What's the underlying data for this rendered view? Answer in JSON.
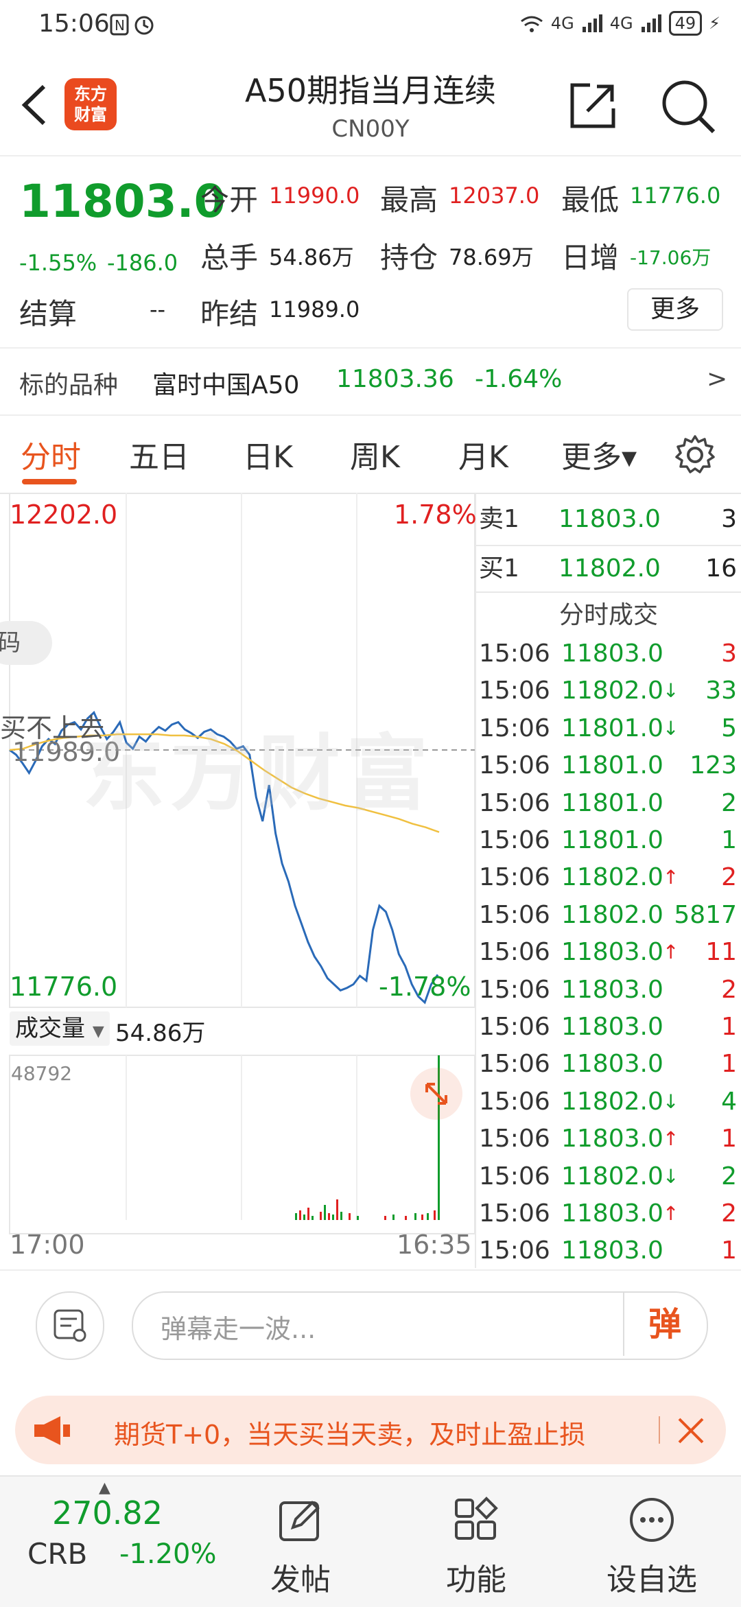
{
  "status_bar": {
    "time": "15:06",
    "battery": "49",
    "net1": "4G",
    "net2": "4G"
  },
  "header": {
    "logo_line1": "东方",
    "logo_line2": "财富",
    "title": "A50期指当月连续",
    "code": "CN00Y"
  },
  "quote": {
    "price": "11803.0",
    "change_pct": "-1.55%",
    "change": "-186.0",
    "open_label": "今开",
    "open": "11990.0",
    "high_label": "最高",
    "high": "12037.0",
    "low_label": "最低",
    "low": "11776.0",
    "volume_label": "总手",
    "volume": "54.86万",
    "oi_label": "持仓",
    "oi": "78.69万",
    "daily_inc_label": "日增",
    "daily_inc": "-17.06万",
    "settle_label": "结算",
    "settle": "--",
    "prev_settle_label": "昨结",
    "prev_settle": "11989.0",
    "more_label": "更多"
  },
  "underlying": {
    "label": "标的品种",
    "name": "富时中国A50",
    "price": "11803.36",
    "change_pct": "-1.64%",
    "arrow": ">"
  },
  "tabs": [
    "分时",
    "五日",
    "日K",
    "周K",
    "月K",
    "更多▾"
  ],
  "chart": {
    "high_price": "12202.0",
    "high_pct": "1.78%",
    "ref_price": "11989.0",
    "low_price": "11776.0",
    "low_pct": "-1.78%",
    "side_pill_text": "码",
    "side_overlay_text": "买不上去",
    "watermark": "东方财富",
    "volume_dropdown": "成交量",
    "volume_value": "54.86万",
    "volume_max": "48792",
    "time_start": "17:00",
    "time_end": "16:35"
  },
  "chart_data": {
    "type": "line",
    "ylim": [
      11776.0,
      12202.0
    ],
    "reference": 11989.0,
    "series": [
      {
        "values": [
          11989,
          11985,
          11978,
          11970,
          11980,
          11992,
          11998,
          11994,
          12005,
          12010,
          12012,
          12006,
          12015,
          12020,
          12008,
          11998,
          12004,
          12012,
          11995,
          11990,
          12000,
          11996,
          12003,
          12008,
          12005,
          12010,
          12012,
          12006,
          12003,
          11999,
          12004,
          12006,
          12002,
          12000,
          11996,
          11990,
          11992,
          11985,
          11950,
          11930,
          11960,
          11920,
          11895,
          11880,
          11860,
          11845,
          11830,
          11818,
          11810,
          11800,
          11795,
          11790,
          11792,
          11795,
          11802,
          11798,
          11840,
          11860,
          11855,
          11840,
          11820,
          11810,
          11795,
          11785,
          11780,
          11795,
          11803
        ]
      },
      {
        "values": [
          11989,
          11990,
          11994,
          11997,
          11999,
          12000,
          12001,
          12001,
          12002,
          12002,
          12002,
          12002,
          12001,
          12001,
          12000,
          11998,
          11994,
          11988,
          11980,
          11972,
          11965,
          11958,
          11953,
          11949,
          11946,
          11943,
          11941,
          11938,
          11935,
          11932,
          11928,
          11925,
          11921
        ]
      }
    ]
  },
  "orderbook": {
    "sell_label": "卖1",
    "sell_price": "11803.0",
    "sell_qty": "3",
    "buy_label": "买1",
    "buy_price": "11802.0",
    "buy_qty": "16",
    "trades_title": "分时成交"
  },
  "trades": [
    {
      "t": "15:06",
      "p": "11803.0",
      "a": "",
      "q": "3",
      "qc": "#e02020"
    },
    {
      "t": "15:06",
      "p": "11802.0",
      "a": "↓",
      "q": "33",
      "qc": "#109c2c"
    },
    {
      "t": "15:06",
      "p": "11801.0",
      "a": "↓",
      "q": "5",
      "qc": "#109c2c"
    },
    {
      "t": "15:06",
      "p": "11801.0",
      "a": "",
      "q": "123",
      "qc": "#109c2c"
    },
    {
      "t": "15:06",
      "p": "11801.0",
      "a": "",
      "q": "2",
      "qc": "#109c2c"
    },
    {
      "t": "15:06",
      "p": "11801.0",
      "a": "",
      "q": "1",
      "qc": "#109c2c"
    },
    {
      "t": "15:06",
      "p": "11802.0",
      "a": "↑",
      "q": "2",
      "qc": "#e02020"
    },
    {
      "t": "15:06",
      "p": "11802.0",
      "a": "",
      "q": "5817",
      "qc": "#109c2c"
    },
    {
      "t": "15:06",
      "p": "11803.0",
      "a": "↑",
      "q": "11",
      "qc": "#e02020"
    },
    {
      "t": "15:06",
      "p": "11803.0",
      "a": "",
      "q": "2",
      "qc": "#e02020"
    },
    {
      "t": "15:06",
      "p": "11803.0",
      "a": "",
      "q": "1",
      "qc": "#e02020"
    },
    {
      "t": "15:06",
      "p": "11803.0",
      "a": "",
      "q": "1",
      "qc": "#e02020"
    },
    {
      "t": "15:06",
      "p": "11802.0",
      "a": "↓",
      "q": "4",
      "qc": "#109c2c"
    },
    {
      "t": "15:06",
      "p": "11803.0",
      "a": "↑",
      "q": "1",
      "qc": "#e02020"
    },
    {
      "t": "15:06",
      "p": "11802.0",
      "a": "↓",
      "q": "2",
      "qc": "#109c2c"
    },
    {
      "t": "15:06",
      "p": "11803.0",
      "a": "↑",
      "q": "2",
      "qc": "#e02020"
    },
    {
      "t": "15:06",
      "p": "11803.0",
      "a": "",
      "q": "1",
      "qc": "#e02020"
    }
  ],
  "danmu": {
    "placeholder": "弹幕走一波...",
    "button": "弹"
  },
  "promo": {
    "text": "期货T+0，当天买当天卖，及时止盈止损"
  },
  "bottom_nav": {
    "crb_value": "270.82",
    "crb_label": "CRB",
    "crb_change": "-1.20%",
    "post": "发帖",
    "features": "功能",
    "watchlist": "设自选"
  },
  "colors": {
    "up": "#e02020",
    "down": "#109c2c",
    "accent": "#e8541e",
    "avg_line": "#f0c040",
    "price_line": "#2a6ab8"
  }
}
